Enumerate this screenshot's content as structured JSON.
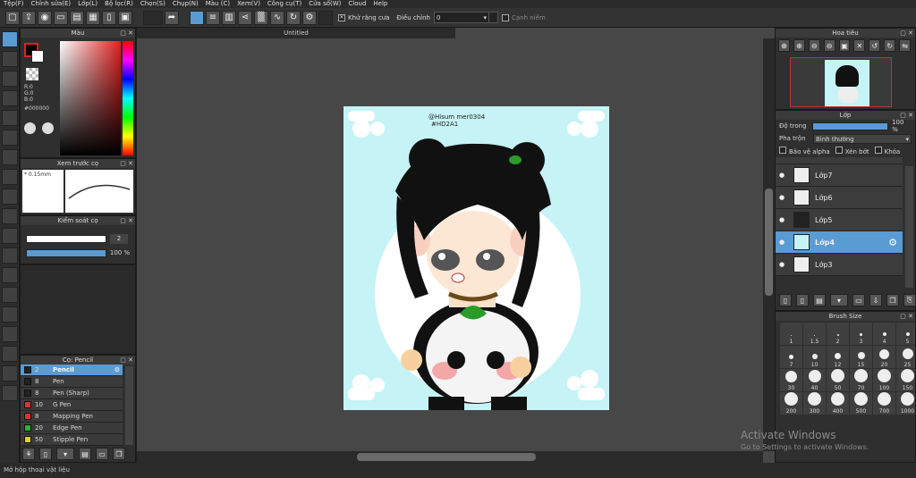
{
  "menu": [
    "Tệp(F)",
    "Chỉnh sửa(E)",
    "Lớp(L)",
    "Bộ lọc(R)",
    "Chọn(S)",
    "Chụp(N)",
    "Màu (C)",
    "Xem(V)",
    "Công cụ(T)",
    "Cửa sổ(W)",
    "Cloud",
    "Help"
  ],
  "toolbar": {
    "antialias_label": "Khử răng cưa",
    "correction_label": "Điều chỉnh",
    "correction_value": "0",
    "edge_label": "Cạnh niềm"
  },
  "color_panel": {
    "title": "Màu",
    "r": "R:0",
    "g": "G:0",
    "b": "B:0",
    "hex": "#000000"
  },
  "brush_preview": {
    "title": "Xem trước cọ",
    "size": "0.15mm"
  },
  "brush_control": {
    "title": "Kiểm soát cọ",
    "size_value": "2",
    "opacity_value": "100 %"
  },
  "brush_list": {
    "title": "Cọ: Pencil",
    "items": [
      {
        "size": "2",
        "name": "Pencil",
        "color": "#222222"
      },
      {
        "size": "8",
        "name": "Pen",
        "color": "#222222"
      },
      {
        "size": "8",
        "name": "Pen (Sharp)",
        "color": "#222222"
      },
      {
        "size": "10",
        "name": "G Pen",
        "color": "#e03030"
      },
      {
        "size": "8",
        "name": "Mapping Pen",
        "color": "#e03030"
      },
      {
        "size": "20",
        "name": "Edge Pen",
        "color": "#30b030"
      },
      {
        "size": "50",
        "name": "Stipple Pen",
        "color": "#e0d020"
      }
    ]
  },
  "document": {
    "title": "Untitled",
    "signature": "@Hisum mer0304 #HD2A1"
  },
  "navigator": {
    "title": "Hoa tiêu"
  },
  "layers": {
    "title": "Lớp",
    "opacity_label": "Độ trong",
    "opacity_value": "100 %",
    "blend_label": "Pha trộn",
    "blend_value": "Bình thường",
    "protect_alpha": "Bảo vệ alpha",
    "clipping": "Xén bớt",
    "lock": "Khóa",
    "items": [
      {
        "name": "Lớp7"
      },
      {
        "name": "Lớp6"
      },
      {
        "name": "Lớp5"
      },
      {
        "name": "Lớp4"
      },
      {
        "name": "Lớp3"
      }
    ]
  },
  "brush_size": {
    "title": "Brush Size",
    "sizes": [
      "1",
      "1.5",
      "2",
      "3",
      "4",
      "5",
      "7",
      "10",
      "12",
      "15",
      "20",
      "25",
      "30",
      "40",
      "50",
      "70",
      "100",
      "150",
      "200",
      "300",
      "400",
      "500",
      "700",
      "1000"
    ]
  },
  "status": "Mở hộp thoại vật liệu",
  "watermark": {
    "line1": "Activate Windows",
    "line2": "Go to Settings to activate Windows."
  }
}
